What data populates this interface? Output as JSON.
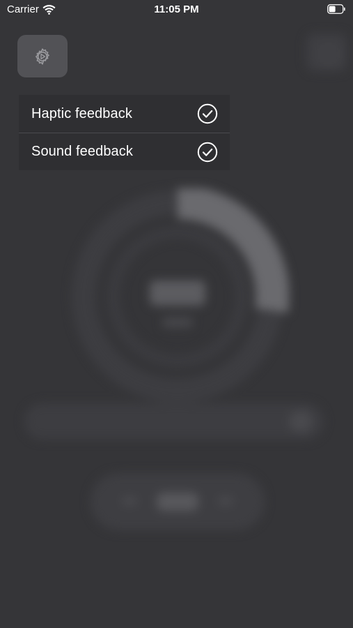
{
  "status_bar": {
    "carrier": "Carrier",
    "time": "11:05 PM",
    "wifi_icon": "wifi-icon",
    "battery_icon": "battery-icon"
  },
  "settings_button": {
    "icon": "gear-icon"
  },
  "menu": {
    "items": [
      {
        "label": "Haptic feedback",
        "checked": true,
        "icon": "checkmark-circle-icon"
      },
      {
        "label": "Sound feedback",
        "checked": true,
        "icon": "checkmark-circle-icon"
      }
    ]
  },
  "colors": {
    "background": "#353538",
    "menu_background": "#2f2f32",
    "button_background": "#525256",
    "text": "#ffffff"
  }
}
